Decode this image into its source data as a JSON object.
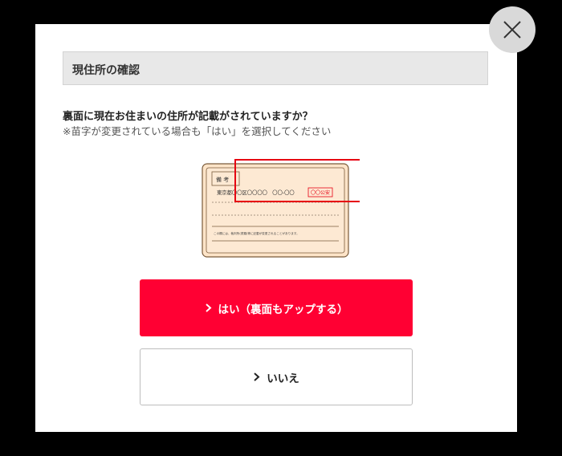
{
  "modal": {
    "title": "現住所の確認",
    "question": "裏面に現在お住まいの住所が記載がされていますか？",
    "note": "※苗字が変更されている場合も「はい」を選択してください",
    "close_icon": "close-icon"
  },
  "card": {
    "label": "備 考",
    "address": "東京都〇〇区〇〇〇〇　〇〇-〇〇",
    "stamp": "〇〇公安",
    "fine_print": "この欄には、裁判所(書類)等に記載が変更されることがあります。"
  },
  "buttons": {
    "yes_label": "はい（裏面もアップする）",
    "no_label": "いいえ",
    "chevron_icon": "chevron-right-icon"
  },
  "colors": {
    "primary": "#ff0033",
    "highlight": "#e60012",
    "card_fill": "#fde4c8"
  }
}
